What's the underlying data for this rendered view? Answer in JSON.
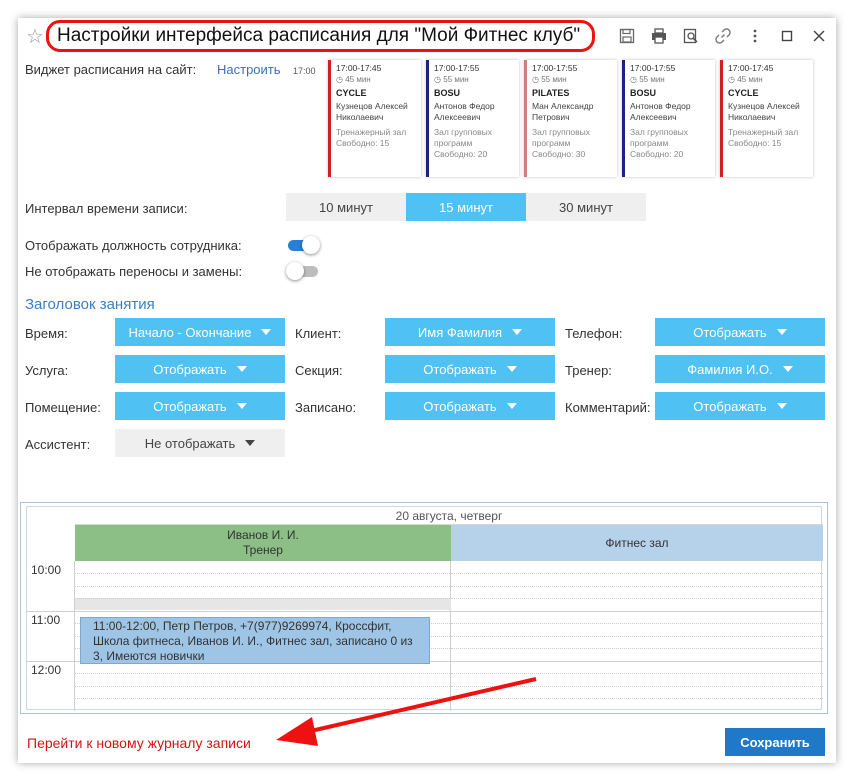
{
  "window": {
    "title": "Настройки интерфейса расписания для \"Мой Фитнес клуб\""
  },
  "widget": {
    "label": "Виджет расписания на сайт:",
    "configure_link": "Настроить",
    "time_marker": "17:00",
    "cards": [
      {
        "time": "17:00-17:45",
        "duration": "45 мин",
        "name": "CYCLE",
        "coach": "Кузнецов Алексей Николаевич",
        "room": "Тренажерный зал",
        "free": "Свободно: 15",
        "color": "#d02020"
      },
      {
        "time": "17:00-17:55",
        "duration": "55 мин",
        "name": "BOSU",
        "coach": "Антонов Федор Алексеевич",
        "room": "Зал групповых программ",
        "free": "Свободно: 20",
        "color": "#1a237e"
      },
      {
        "time": "17:00-17:55",
        "duration": "55 мин",
        "name": "PILATES",
        "coach": "Ман Александр Петрович",
        "room": "Зал групповых программ",
        "free": "Свободно: 30",
        "color": "#d08080"
      },
      {
        "time": "17:00-17:55",
        "duration": "55 мин",
        "name": "BOSU",
        "coach": "Антонов Федор Алексеевич",
        "room": "Зал групповых программ",
        "free": "Свободно: 20",
        "color": "#1a237e"
      },
      {
        "time": "17:00-17:45",
        "duration": "45 мин",
        "name": "CYCLE",
        "coach": "Кузнецов Алексей Николаевич",
        "room": "Тренажерный зал",
        "free": "Свободно: 15",
        "color": "#d02020"
      }
    ]
  },
  "interval": {
    "label": "Интервал времени записи:",
    "options": [
      "10 минут",
      "15 минут",
      "30 минут"
    ],
    "selected": "15 минут"
  },
  "toggles": {
    "show_position": {
      "label": "Отображать должность сотрудника:",
      "on": true
    },
    "hide_transfers": {
      "label": "Не отображать переносы и замены:",
      "on": false
    }
  },
  "header_section": {
    "title": "Заголовок занятия",
    "fields": {
      "time": {
        "label": "Время:",
        "value": "Начало - Окончание"
      },
      "client": {
        "label": "Клиент:",
        "value": "Имя Фамилия"
      },
      "phone": {
        "label": "Телефон:",
        "value": "Отображать"
      },
      "service": {
        "label": "Услуга:",
        "value": "Отображать"
      },
      "section": {
        "label": "Секция:",
        "value": "Отображать"
      },
      "trainer": {
        "label": "Тренер:",
        "value": "Фамилия И.О."
      },
      "room": {
        "label": "Помещение:",
        "value": "Отображать"
      },
      "booked": {
        "label": "Записано:",
        "value": "Отображать"
      },
      "comment": {
        "label": "Комментарий:",
        "value": "Отображать"
      },
      "assistant": {
        "label": "Ассистент:",
        "value": "Не отображать"
      }
    }
  },
  "schedule": {
    "date": "20 августа, четверг",
    "col_a_name": "Иванов И. И.",
    "col_a_role": "Тренер",
    "col_b_name": "Фитнес зал",
    "hours": [
      "10:00",
      "11:00",
      "12:00"
    ],
    "event_text": "11:00-12:00, Петр Петров, +7(977)9269974, Кроссфит, Школа фитнеса, Иванов И. И., Фитнес зал, записано 0 из 3, Имеются новички"
  },
  "footer": {
    "journal_link": "Перейти к новому журналу записи",
    "save_label": "Сохранить"
  },
  "colors": {
    "accent": "#4fc1f2",
    "primary_button": "#1f78c8",
    "annotation_red": "#ee1111"
  }
}
